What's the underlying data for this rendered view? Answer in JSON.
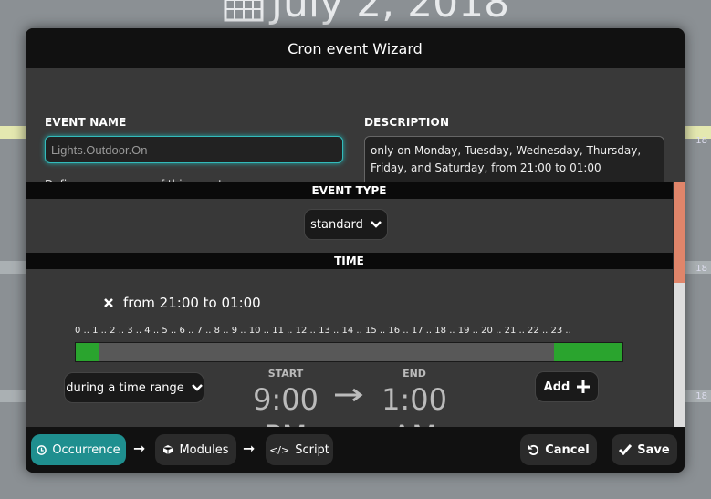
{
  "background": {
    "date": "July 2, 2018",
    "side_number": "18"
  },
  "dialog": {
    "title": "Cron event Wizard",
    "event_name": {
      "label": "EVENT NAME",
      "value": "Lights.Outdoor.On"
    },
    "description": {
      "label": "DESCRIPTION",
      "text": "only on Monday, Tuesday, Wednesday, Thursday, Friday, and Saturday, from 21:00 to 01:00"
    },
    "hint": "Define occurrences of this event",
    "event_type": {
      "header": "EVENT TYPE",
      "value": "standard"
    },
    "time": {
      "header": "TIME",
      "range_text": "from 21:00 to 01:00",
      "hours_axis": "0 .. 1 .. 2 .. 3 .. 4 .. 5 .. 6 .. 7 .. 8 .. 9 .. 10 .. 11 .. 12 .. 13 .. 14 .. 15 .. 16 .. 17 .. 18 .. 19 .. 20 .. 21 .. 22 .. 23 ..",
      "selected_hours": {
        "from": 21,
        "to": 1
      },
      "mode": "during a time range",
      "start_label": "START",
      "start_time": "9:00",
      "start_ampm": "PM",
      "end_label": "END",
      "end_time": "1:00",
      "end_ampm": "AM",
      "add_label": "Add"
    },
    "footer": {
      "occurrence": "Occurrence",
      "modules": "Modules",
      "script": "Script",
      "cancel": "Cancel",
      "save": "Save"
    },
    "colors": {
      "accent": "#1f8f8f",
      "range_green": "#2aa42e",
      "scroll_thumb": "#e0856a"
    }
  }
}
